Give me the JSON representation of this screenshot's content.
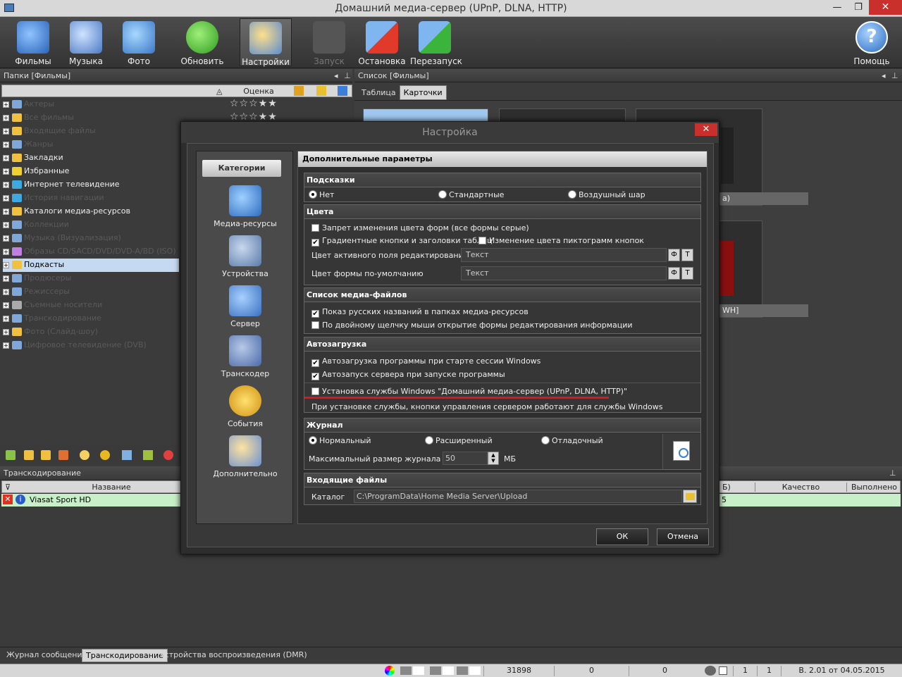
{
  "window": {
    "title": "Домашний медиа-сервер (UPnP, DLNA, HTTP)",
    "minimize": "—",
    "restore": "❐",
    "close": "✕"
  },
  "toolbar": {
    "films": "Фильмы",
    "music": "Музыка",
    "photo": "Фото",
    "refresh": "Обновить",
    "settings": "Настройки",
    "start": "Запуск",
    "stop": "Остановка",
    "restart": "Перезапуск",
    "help": "Помощь"
  },
  "left_panel": {
    "header": "Папки [Фильмы]",
    "rating_col": "Оценка",
    "tree": [
      "Актеры",
      "Все фильмы",
      "Входящие файлы",
      "Жанры",
      "Закладки",
      "Избранные",
      "Интернет телевидение",
      "История навигации",
      "Каталоги медиа-ресурсов",
      "Коллекции",
      "Музыка (Визуализация)",
      "Образы CD/SACD/DVD/DVD-A/BD (ISO)",
      "Подкасты",
      "Продюсеры",
      "Режиссеры",
      "Съемные носители",
      "Транскодирование",
      "Фото (Слайд-шоу)",
      "Цифровое телевидение (DVB)"
    ]
  },
  "right_panel": {
    "header": "Список [Фильмы]",
    "tab_table": "Таблица",
    "tab_cards": "Карточки",
    "card_caption_1": "а)",
    "card_caption_2": "WH]"
  },
  "transcode": {
    "header": "Транскодирование",
    "col_name": "Название",
    "col_b": "Б)",
    "col_quality": "Качество",
    "col_done": "Выполнено",
    "row_name": "Viasat Sport HD",
    "row_b": "5"
  },
  "dialog": {
    "title": "Настройка",
    "close": "✕",
    "categories_header": "Категории",
    "categories": [
      "Медиа-ресурсы",
      "Устройства",
      "Сервер",
      "Транскодер",
      "События",
      "Дополнительно"
    ],
    "section_title": "Дополнительные параметры",
    "hints": {
      "title": "Подсказки",
      "none": "Нет",
      "standard": "Стандартные",
      "balloon": "Воздушный шар"
    },
    "colors": {
      "title": "Цвета",
      "forbid_color": "Запрет изменения цвета форм (все формы серые)",
      "gradient": "Градиентные кнопки и заголовки таблиц",
      "icon_color": "Изменение цвета пиктограмм кнопок",
      "active_field_label": "Цвет активного поля редактирования",
      "active_field_value": "Текст",
      "default_form_label": "Цвет формы по-умолчанию",
      "default_form_value": "Текст",
      "btn_f": "Ф",
      "btn_t": "Т"
    },
    "media_list": {
      "title": "Список медиа-файлов",
      "russian_names": "Показ русских названий в папках медиа-ресурсов",
      "double_click": "По двойному щелчку мыши открытие формы редактирования информации"
    },
    "autoload": {
      "title": "Автозагрузка",
      "autostart_program": "Автозагрузка программы при старте сессии Windows",
      "autostart_server": "Автозапуск сервера при запуске программы",
      "install_service": "Установка службы Windows \"Домашний медиа-сервер (UPnP, DLNA, HTTP)\"",
      "note": "При установке службы, кнопки управления сервером работают для службы Windows"
    },
    "journal": {
      "title": "Журнал",
      "normal": "Нормальный",
      "extended": "Расширенный",
      "debug": "Отладочный",
      "max_size_label": "Максимальный размер журнала",
      "max_size_value": "50",
      "unit": "МБ"
    },
    "incoming": {
      "title": "Входящие файлы",
      "catalog_label": "Каталог",
      "catalog_value": "C:\\ProgramData\\Home Media Server\\Upload"
    },
    "ok": "ОК",
    "cancel": "Отмена"
  },
  "bottom_tabs": {
    "messages": "Журнал сообщений",
    "transcoding": "Транскодирование",
    "dmr": "Устройства воспроизведения (DMR)"
  },
  "status": {
    "count": "31898",
    "v1": "0",
    "v2": "0",
    "p1": "1",
    "p2": "1",
    "version": "В. 2.01 от 04.05.2015"
  },
  "colors": {
    "accent_red": "#e0141e",
    "selection": "#c5d9f0",
    "transcode_row": "#c8f0c8"
  }
}
